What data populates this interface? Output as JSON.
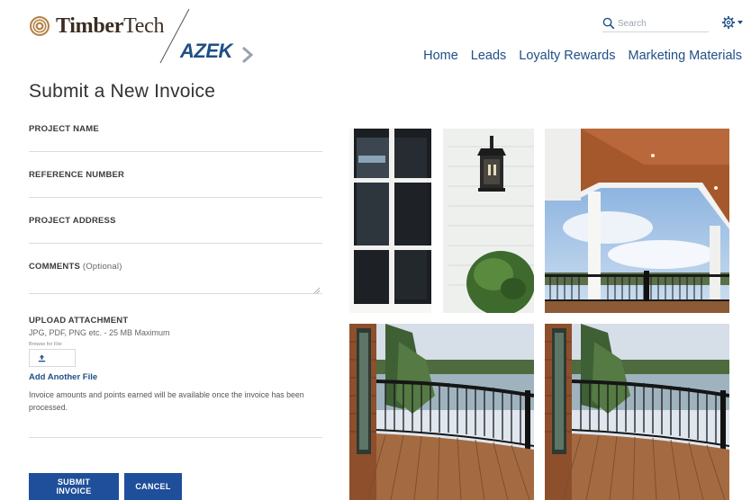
{
  "brand": {
    "timber_bold": "Timber",
    "timber_light": "Tech",
    "azek": "AZEK"
  },
  "search": {
    "placeholder": "Search"
  },
  "nav": {
    "items": [
      "Home",
      "Leads",
      "Loyalty Rewards",
      "Marketing Materials"
    ]
  },
  "page": {
    "title": "Submit a New Invoice"
  },
  "form": {
    "project_name_label": "PROJECT NAME",
    "reference_number_label": "REFERENCE NUMBER",
    "project_address_label": "PROJECT ADDRESS",
    "comments_label": "COMMENTS",
    "comments_optional": "(Optional)",
    "upload_label": "UPLOAD ATTACHMENT",
    "upload_hint": "JPG, PDF, PNG etc. - 25 MB Maximum",
    "browse_label": "Browse for File",
    "add_file": "Add Another File",
    "note": "Invoice amounts and points earned will be available once the invoice has been processed."
  },
  "buttons": {
    "submit": "SUBMIT INVOICE",
    "cancel": "CANCEL"
  },
  "colors": {
    "brand_blue": "#1f4f86",
    "button_blue": "#1f4f9a"
  }
}
